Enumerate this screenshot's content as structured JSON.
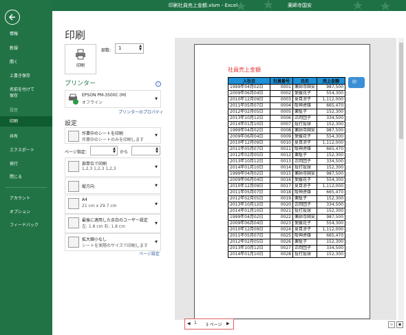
{
  "window": {
    "title": "印刷社員売上金額.xlsm - Excel",
    "user": "薬師寺国安"
  },
  "sidebar": {
    "items": [
      {
        "label": "情報",
        "state": "normal"
      },
      {
        "label": "新規",
        "state": "normal"
      },
      {
        "label": "開く",
        "state": "normal"
      },
      {
        "label": "上書き保存",
        "state": "normal"
      },
      {
        "label": "名前を付けて\n保存",
        "state": "normal"
      },
      {
        "label": "履歴",
        "state": "disabled"
      },
      {
        "label": "印刷",
        "state": "selected"
      },
      {
        "label": "共有",
        "state": "normal"
      },
      {
        "label": "エクスポート",
        "state": "normal"
      },
      {
        "label": "発行",
        "state": "normal"
      },
      {
        "label": "閉じる",
        "state": "normal"
      },
      {
        "label": "アカウント",
        "state": "normal"
      },
      {
        "label": "オプション",
        "state": "normal"
      },
      {
        "label": "フィードバック",
        "state": "normal"
      }
    ]
  },
  "print": {
    "title": "印刷",
    "print_button": "印刷",
    "copies_label": "部数:",
    "copies_value": "1",
    "printer_heading": "プリンター",
    "printer_name": "EPSON PM-3500C (M)",
    "printer_status": "オフライン",
    "printer_properties": "プリンターのプロパティ",
    "settings_heading": "設定",
    "pages_label": "ページ指定:",
    "to_label": "から",
    "settings": [
      {
        "l1": "作業中のシートを印刷",
        "l2": "作業中のシートのみを印刷します"
      },
      {
        "l1": "部単位で印刷",
        "l2": "1,2,3    1,2,3    1,2,3"
      },
      {
        "l1": "縦方向",
        "l2": ""
      },
      {
        "l1": "A4",
        "l2": "21 cm x 29.7 cm"
      },
      {
        "l1": "最後に適用した余白のユーザー設定",
        "l2": "左:  1.8 cm    右:  1.8 cm"
      },
      {
        "l1": "拡大縮小なし",
        "l2": "シートを実際のサイズで印刷します"
      }
    ],
    "page_setup": "ページ設定"
  },
  "preview": {
    "sheet_title": "社員売上金額",
    "side_button": "印",
    "headers": [
      "入社日",
      "社員番号",
      "氏名",
      "売上金額"
    ],
    "rows": [
      [
        "1999年04月02日",
        "0001",
        "薬師寺国安",
        "987,500"
      ],
      [
        "2009年06月04日",
        "0002",
        "愛媛花子",
        "554,300"
      ],
      [
        "2010年12月09日",
        "0003",
        "夏目涼子",
        "1,112,000"
      ],
      [
        "2011年05月07日",
        "0004",
        "阪神虎雄",
        "665,470"
      ],
      [
        "2012年02月05日",
        "0005",
        "栗駈子",
        "152,300"
      ],
      [
        "2013年10月12日",
        "0006",
        "正岡団子",
        "334,500"
      ],
      [
        "2014年01月10日",
        "0007",
        "投打投球",
        "152,300"
      ],
      [
        "1999年04月02日",
        "0008",
        "薬師寺国安",
        "987,500"
      ],
      [
        "2009年06月04日",
        "0009",
        "愛媛花子",
        "554,300"
      ],
      [
        "2010年12月09日",
        "0010",
        "夏目涼子",
        "1,112,000"
      ],
      [
        "2011年05月07日",
        "0011",
        "阪神虎雄",
        "665,470"
      ],
      [
        "2012年02月05日",
        "0012",
        "栗駈子",
        "152,300"
      ],
      [
        "2013年10月12日",
        "0013",
        "正岡団子",
        "334,500"
      ],
      [
        "2014年01月10日",
        "0014",
        "投打投球",
        "152,300"
      ],
      [
        "1999年04月02日",
        "0015",
        "薬師寺国安",
        "987,500"
      ],
      [
        "2009年06月04日",
        "0016",
        "愛媛花子",
        "554,300"
      ],
      [
        "2010年12月09日",
        "0017",
        "夏目涼子",
        "1,112,000"
      ],
      [
        "2011年05月07日",
        "0018",
        "阪神虎雄",
        "665,470"
      ],
      [
        "2012年02月05日",
        "0019",
        "栗駈子",
        "152,300"
      ],
      [
        "2013年10月12日",
        "0020",
        "正岡団子",
        "334,500"
      ],
      [
        "2014年01月10日",
        "0021",
        "投打投球",
        "152,300"
      ],
      [
        "1999年04月02日",
        "0022",
        "薬師寺国安",
        "987,500"
      ],
      [
        "2009年06月04日",
        "0023",
        "愛媛花子",
        "554,300"
      ],
      [
        "2010年12月09日",
        "0024",
        "夏目涼子",
        "1,112,000"
      ],
      [
        "2011年05月07日",
        "0025",
        "阪神虎雄",
        "665,470"
      ],
      [
        "2012年02月05日",
        "0026",
        "栗駈子",
        "152,300"
      ],
      [
        "2013年10月12日",
        "0027",
        "正岡団子",
        "334,500"
      ],
      [
        "2014年01月10日",
        "0028",
        "投打投球",
        "152,300"
      ]
    ]
  },
  "nav": {
    "current_page": "1",
    "of_pages": "3 ページ"
  }
}
